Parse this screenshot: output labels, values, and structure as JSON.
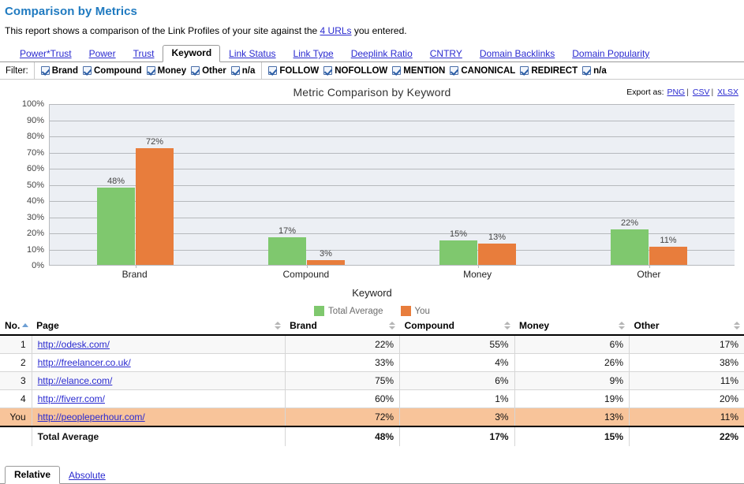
{
  "header": {
    "title": "Comparison by Metrics",
    "description_before": "This report shows a comparison of the Link Profiles of your site against the ",
    "description_link": "4 URLs",
    "description_after": " you entered."
  },
  "tabs": [
    {
      "label": "Power*Trust",
      "active": false
    },
    {
      "label": "Power",
      "active": false
    },
    {
      "label": "Trust",
      "active": false
    },
    {
      "label": "Keyword",
      "active": true
    },
    {
      "label": "Link Status",
      "active": false
    },
    {
      "label": "Link Type",
      "active": false
    },
    {
      "label": "Deeplink Ratio",
      "active": false
    },
    {
      "label": "CNTRY",
      "active": false
    },
    {
      "label": "Domain Backlinks",
      "active": false
    },
    {
      "label": "Domain Popularity",
      "active": false
    }
  ],
  "filter": {
    "label": "Filter:",
    "group1": [
      {
        "label": "Brand",
        "checked": true
      },
      {
        "label": "Compound",
        "checked": true
      },
      {
        "label": "Money",
        "checked": true
      },
      {
        "label": "Other",
        "checked": true
      },
      {
        "label": "n/a",
        "checked": true
      }
    ],
    "group2": [
      {
        "label": "FOLLOW",
        "checked": true
      },
      {
        "label": "NOFOLLOW",
        "checked": true
      },
      {
        "label": "MENTION",
        "checked": true
      },
      {
        "label": "CANONICAL",
        "checked": true
      },
      {
        "label": "REDIRECT",
        "checked": true
      },
      {
        "label": "n/a",
        "checked": true
      }
    ]
  },
  "export": {
    "label": "Export as:",
    "png": "PNG",
    "csv": "CSV",
    "xlsx": "XLSX",
    "separator": "|"
  },
  "chart_data": {
    "type": "bar",
    "title": "Metric Comparison by Keyword",
    "xlabel": "Keyword",
    "ylabel": "",
    "categories": [
      "Brand",
      "Compound",
      "Money",
      "Other"
    ],
    "series": [
      {
        "name": "Total Average",
        "color": "#7fc86e",
        "values": [
          48,
          17,
          15,
          22
        ],
        "labels": [
          "48%",
          "17%",
          "15%",
          "22%"
        ]
      },
      {
        "name": "You",
        "color": "#e87d3c",
        "values": [
          72,
          3,
          13,
          11
        ],
        "labels": [
          "72%",
          "3%",
          "13%",
          "11%"
        ]
      }
    ],
    "ylim": [
      0,
      100
    ],
    "ytick_values": [
      100,
      90,
      80,
      70,
      60,
      50,
      40,
      30,
      20,
      10,
      0
    ],
    "yticks": [
      "100%",
      "90%",
      "80%",
      "70%",
      "60%",
      "50%",
      "40%",
      "30%",
      "20%",
      "10%",
      "0%"
    ],
    "grid": true,
    "legend_position": "bottom",
    "plot_bg": "#eceff4"
  },
  "table": {
    "headers": {
      "no": "No.",
      "page": "Page",
      "brand": "Brand",
      "compound": "Compound",
      "money": "Money",
      "other": "Other"
    },
    "sorted_column": "No.",
    "sort_direction": "asc",
    "rows": [
      {
        "no": "1",
        "page": "http://odesk.com/",
        "brand": "22%",
        "compound": "55%",
        "money": "6%",
        "other": "17%",
        "highlight": false
      },
      {
        "no": "2",
        "page": "http://freelancer.co.uk/",
        "brand": "33%",
        "compound": "4%",
        "money": "26%",
        "other": "38%",
        "highlight": false
      },
      {
        "no": "3",
        "page": "http://elance.com/",
        "brand": "75%",
        "compound": "6%",
        "money": "9%",
        "other": "11%",
        "highlight": false
      },
      {
        "no": "4",
        "page": "http://fiverr.com/",
        "brand": "60%",
        "compound": "1%",
        "money": "19%",
        "other": "20%",
        "highlight": false
      },
      {
        "no": "You",
        "page": "http://peopleperhour.com/",
        "brand": "72%",
        "compound": "3%",
        "money": "13%",
        "other": "11%",
        "highlight": true
      }
    ],
    "total": {
      "no": "",
      "page": "Total Average",
      "brand": "48%",
      "compound": "17%",
      "money": "15%",
      "other": "22%"
    }
  },
  "bottom_tabs": [
    {
      "label": "Relative",
      "active": true
    },
    {
      "label": "Absolute",
      "active": false
    }
  ],
  "colors": {
    "title": "#1f7ac0",
    "link": "#2a2ad0",
    "avg_bar": "#7fc86e",
    "you_bar": "#e87d3c",
    "you_row": "#f8c49a"
  }
}
